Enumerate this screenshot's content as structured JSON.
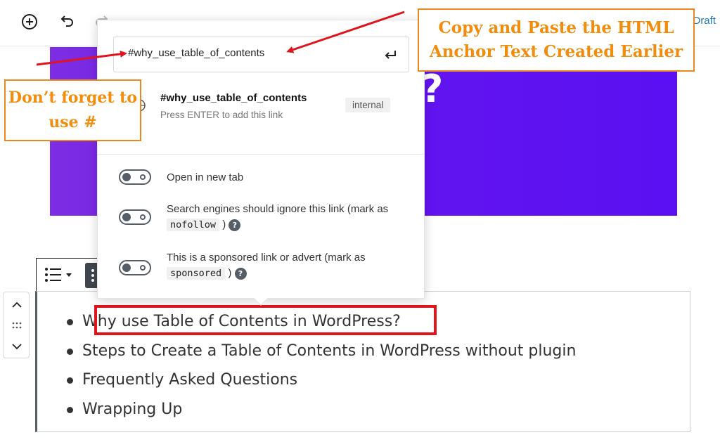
{
  "toolbar": {
    "draft_label": "Draft"
  },
  "link_popover": {
    "url_value": "#why_use_table_of_contents",
    "suggestion": {
      "title": "#why_use_table_of_contents",
      "hint": "Press ENTER to add this link",
      "badge": "internal"
    },
    "options": [
      {
        "label": "Open in new tab"
      },
      {
        "label_before": "Search engines should ignore this link (mark as",
        "code": "nofollow",
        "label_after": ")"
      },
      {
        "label_before": "This is a sponsored link or advert (mark as",
        "code": "sponsored",
        "label_after": ")"
      }
    ]
  },
  "hero": {
    "glyph": "?"
  },
  "list": {
    "items": [
      "Why use Table of Contents in WordPress?",
      "Steps to Create a Table of Contents in WordPress without plugin",
      "Frequently Asked Questions",
      "Wrapping Up"
    ]
  },
  "annotations": {
    "copy_line1": "Copy and Paste the HTML",
    "copy_line2": "Anchor Text Created Earlier",
    "hash_line1": "Don’t forget to",
    "hash_line2": "use #"
  },
  "colors": {
    "annotation_orange": "#f28c0c",
    "arrow_red": "#e0141c",
    "hero_purple": "#6416ee"
  }
}
